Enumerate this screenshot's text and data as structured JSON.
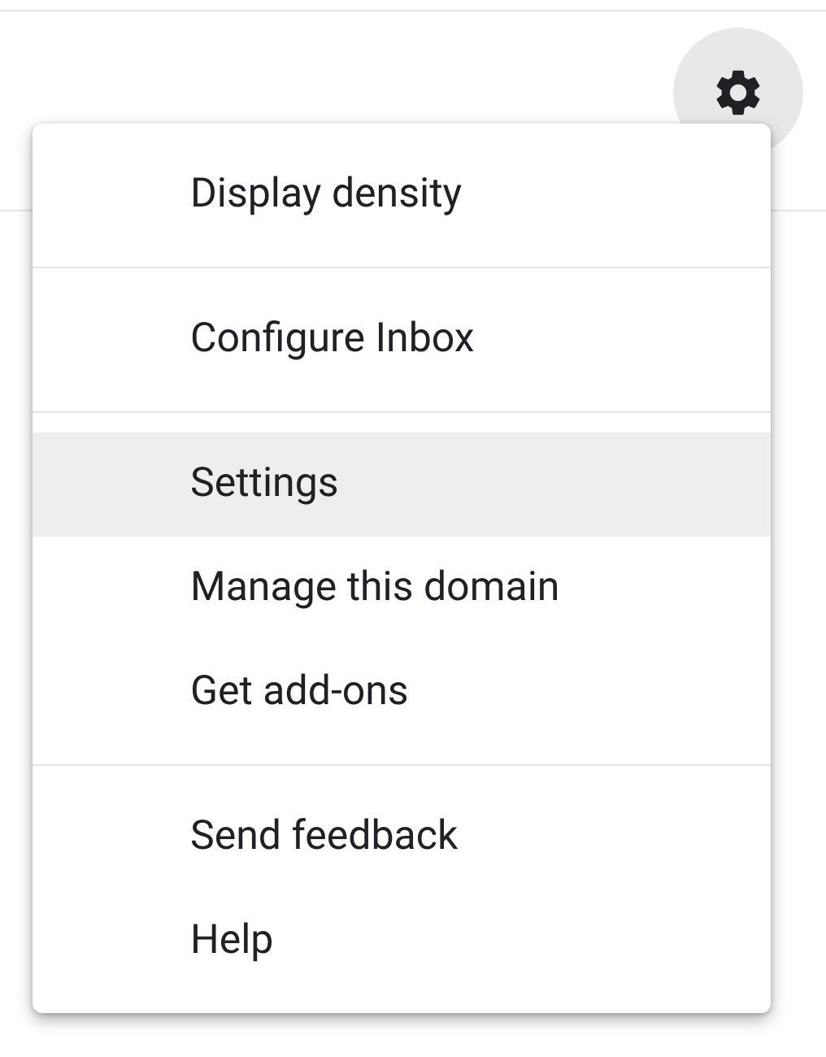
{
  "menu": {
    "sections": [
      {
        "items": [
          {
            "label": "Display density",
            "selected": false
          }
        ]
      },
      {
        "items": [
          {
            "label": "Configure Inbox",
            "selected": false
          }
        ]
      },
      {
        "items": [
          {
            "label": "Settings",
            "selected": true
          },
          {
            "label": "Manage this domain",
            "selected": false
          },
          {
            "label": "Get add-ons",
            "selected": false
          }
        ]
      },
      {
        "items": [
          {
            "label": "Send feedback",
            "selected": false
          },
          {
            "label": "Help",
            "selected": false
          }
        ]
      }
    ]
  }
}
